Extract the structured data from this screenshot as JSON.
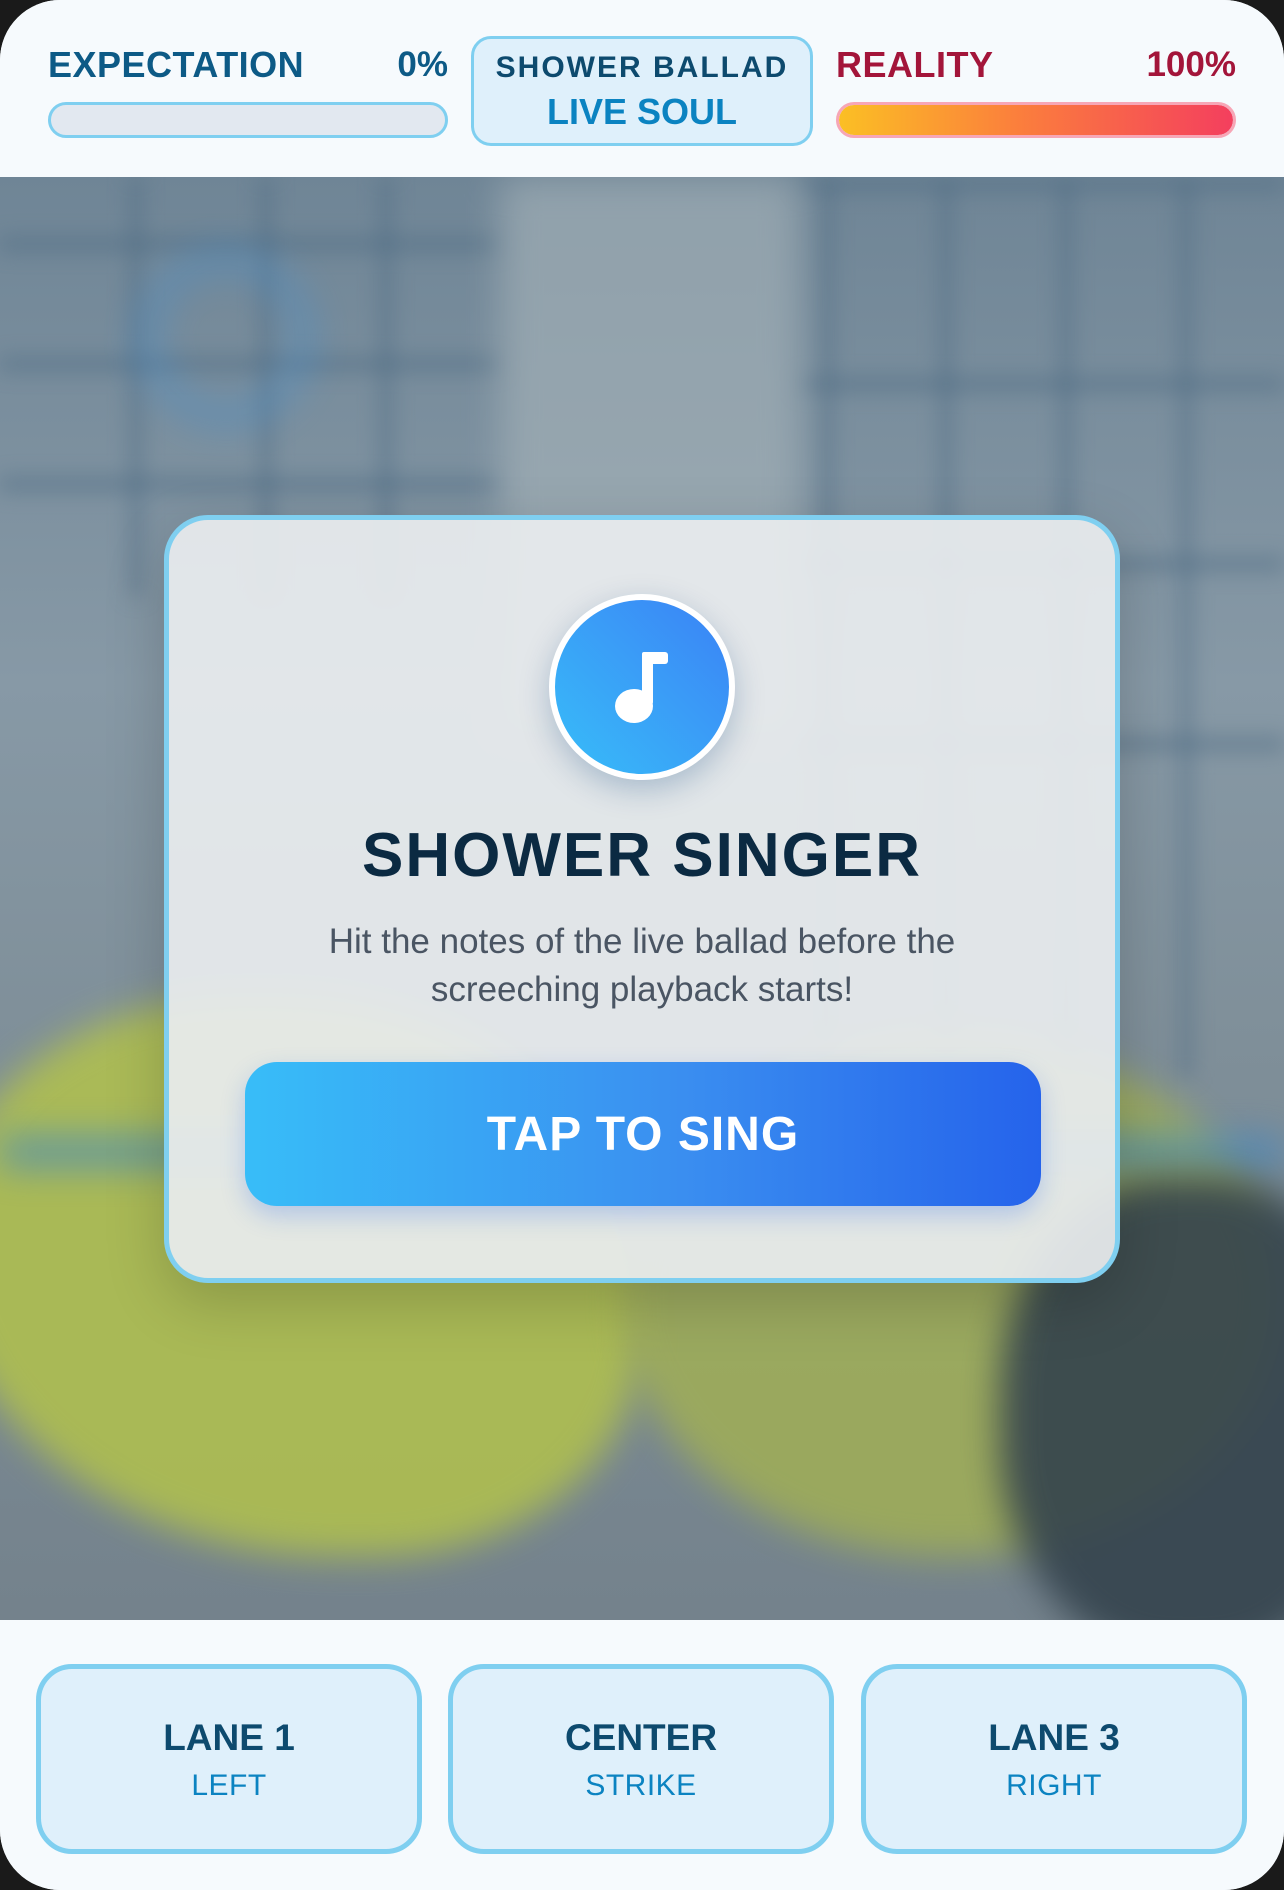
{
  "hud": {
    "expectation": {
      "label": "EXPECTATION",
      "percent_text": "0%",
      "level": 0.0
    },
    "song": {
      "title": "SHOWER BALLAD",
      "subtitle": "LIVE SOUL"
    },
    "reality": {
      "label": "REALITY",
      "percent_text": "100%",
      "level": 1.0
    }
  },
  "modal": {
    "icon": "music-note-icon",
    "title": "SHOWER SINGER",
    "description": "Hit the notes of the live ballad before the screeching playback starts!",
    "start_label": "TAP TO SING"
  },
  "controls": {
    "lanes": [
      {
        "title": "LANE 1",
        "sub": "LEFT"
      },
      {
        "title": "CENTER",
        "sub": "STRIKE"
      },
      {
        "title": "LANE 3",
        "sub": "RIGHT"
      }
    ]
  },
  "colors": {
    "accent_blue": "#3b82f6",
    "accent_sky": "#38bdf8",
    "border_sky": "#7fcff0",
    "reality_red": "#a3153a",
    "expectation_blue": "#0d5a86"
  }
}
